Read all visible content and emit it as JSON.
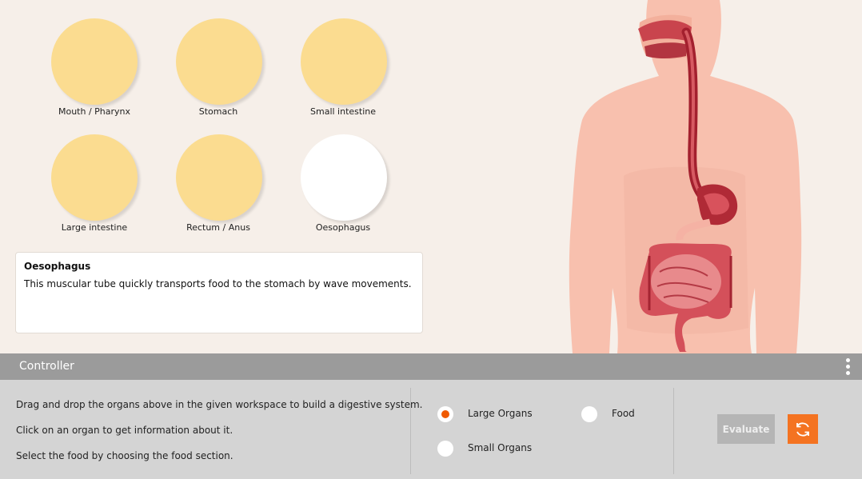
{
  "organs": [
    {
      "label": "Mouth / Pharynx",
      "color": "#fbdc90"
    },
    {
      "label": "Stomach",
      "color": "#fbdc90"
    },
    {
      "label": "Small intestine",
      "color": "#fbdc90"
    },
    {
      "label": "Large intestine",
      "color": "#fbdc90"
    },
    {
      "label": "Rectum / Anus",
      "color": "#fbdc90"
    },
    {
      "label": "Oesophagus",
      "color": "#ffffff"
    }
  ],
  "info": {
    "title": "Oesophagus",
    "text": "This muscular tube quickly transports food to the stomach by wave movements."
  },
  "controller": {
    "title": "Controller",
    "instructions": [
      "Drag and drop the organs above in the given workspace to build a digestive system.",
      "Click on an organ to get information about it.",
      "Select the food by choosing the food section."
    ],
    "options": [
      {
        "label": "Large Organs",
        "selected": true
      },
      {
        "label": "Food",
        "selected": false
      },
      {
        "label": "Small Organs",
        "selected": false
      }
    ],
    "evaluate_label": "Evaluate",
    "accent_color": "#f05a00"
  },
  "icons": {
    "menu": "more-vertical-icon",
    "reset": "refresh-icon"
  }
}
